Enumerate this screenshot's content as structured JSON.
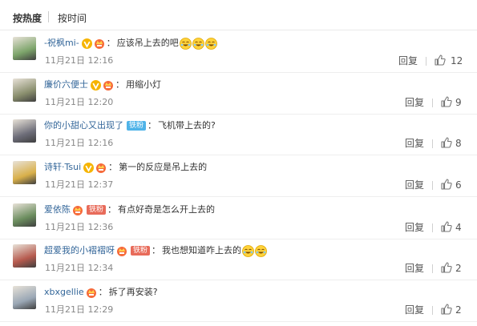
{
  "sort": {
    "hot": "按热度",
    "time": "按时间"
  },
  "comments": [
    {
      "name": "-祝枫mi-",
      "verified": true,
      "badge": "crown",
      "fan": "",
      "text": "应该吊上去的吧",
      "emoji_count": 3,
      "time": "11月21日 12:16",
      "reply": "回复",
      "likes": "12",
      "avatar_color": "#7da56b"
    },
    {
      "name": "廉价六便士",
      "verified": true,
      "badge": "crown",
      "fan": "",
      "text": "用缩小灯",
      "emoji_count": 0,
      "time": "11月21日 12:20",
      "reply": "回复",
      "likes": "9",
      "avatar_color": "#8a8f6e"
    },
    {
      "name": "你的小甜心又出现了",
      "verified": false,
      "badge": "",
      "fan": "铁粉",
      "text": "飞机带上去的?",
      "emoji_count": 0,
      "time": "11月21日 12:16",
      "reply": "回复",
      "likes": "8",
      "avatar_color": "#6e6e7a"
    },
    {
      "name": "诗轩·Tsui",
      "verified": true,
      "badge": "crown",
      "fan": "",
      "text": "第一的反应是吊上去的",
      "emoji_count": 0,
      "time": "11月21日 12:37",
      "reply": "回复",
      "likes": "6",
      "avatar_color": "#d9b04a"
    },
    {
      "name": "爱依陈",
      "verified": false,
      "badge": "crown",
      "fan": "铁粉",
      "text": "有点好奇是怎么开上去的",
      "emoji_count": 0,
      "time": "11月21日 12:36",
      "reply": "回复",
      "likes": "4",
      "avatar_color": "#6b8d5e"
    },
    {
      "name": "超爱我的小褶褶呀",
      "verified": false,
      "badge": "crown",
      "fan": "铁粉",
      "text": "我也想知道咋上去的",
      "emoji_count": 2,
      "time": "11月21日 12:34",
      "reply": "回复",
      "likes": "2",
      "avatar_color": "#b65a4e"
    },
    {
      "name": "xbxgellie",
      "verified": false,
      "badge": "crown",
      "fan": "",
      "text": "拆了再安装?",
      "emoji_count": 0,
      "time": "11月21日 12:29",
      "reply": "回复",
      "likes": "2",
      "avatar_color": "#9aa7b5"
    }
  ]
}
